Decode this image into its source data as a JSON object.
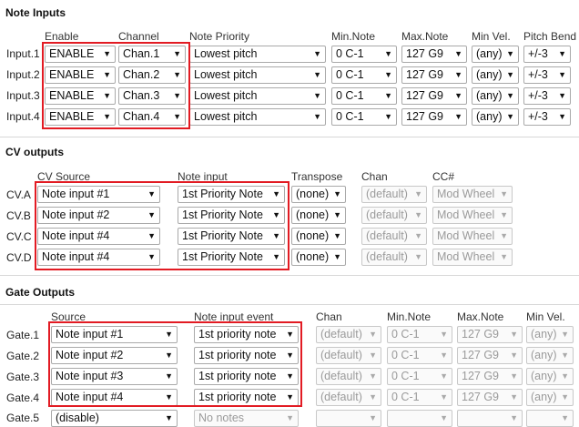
{
  "note_inputs": {
    "title": "Note Inputs",
    "headers": [
      "Enable",
      "Channel",
      "Note Priority",
      "Min.Note",
      "Max.Note",
      "Min Vel.",
      "Pitch Bend"
    ],
    "rows": [
      {
        "label": "Input.1",
        "values": [
          "ENABLE",
          "Chan.1",
          "Lowest pitch",
          "0 C-1",
          "127 G9",
          "(any)",
          "+/-3"
        ]
      },
      {
        "label": "Input.2",
        "values": [
          "ENABLE",
          "Chan.2",
          "Lowest pitch",
          "0 C-1",
          "127 G9",
          "(any)",
          "+/-3"
        ]
      },
      {
        "label": "Input.3",
        "values": [
          "ENABLE",
          "Chan.3",
          "Lowest pitch",
          "0 C-1",
          "127 G9",
          "(any)",
          "+/-3"
        ]
      },
      {
        "label": "Input.4",
        "values": [
          "ENABLE",
          "Chan.4",
          "Lowest pitch",
          "0 C-1",
          "127 G9",
          "(any)",
          "+/-3"
        ]
      }
    ]
  },
  "cv_outputs": {
    "title": "CV outputs",
    "headers": [
      "CV Source",
      "Note input",
      "Transpose",
      "Chan",
      "CC#"
    ],
    "rows": [
      {
        "label": "CV.A",
        "values": [
          "Note input #1",
          "1st Priority Note",
          "(none)",
          "(default)",
          "Mod Wheel"
        ]
      },
      {
        "label": "CV.B",
        "values": [
          "Note input #2",
          "1st Priority Note",
          "(none)",
          "(default)",
          "Mod Wheel"
        ]
      },
      {
        "label": "CV.C",
        "values": [
          "Note input #4",
          "1st Priority Note",
          "(none)",
          "(default)",
          "Mod Wheel"
        ]
      },
      {
        "label": "CV.D",
        "values": [
          "Note input #4",
          "1st Priority Note",
          "(none)",
          "(default)",
          "Mod Wheel"
        ]
      }
    ]
  },
  "gate_outputs": {
    "title": "Gate Outputs",
    "headers": [
      "Source",
      "Note input event",
      "Chan",
      "Min.Note",
      "Max.Note",
      "Min Vel."
    ],
    "rows": [
      {
        "label": "Gate.1",
        "values": [
          "Note input #1",
          "1st priority note",
          "(default)",
          "0 C-1",
          "127 G9",
          "(any)"
        ]
      },
      {
        "label": "Gate.2",
        "values": [
          "Note input #2",
          "1st priority note",
          "(default)",
          "0 C-1",
          "127 G9",
          "(any)"
        ]
      },
      {
        "label": "Gate.3",
        "values": [
          "Note input #3",
          "1st priority note",
          "(default)",
          "0 C-1",
          "127 G9",
          "(any)"
        ]
      },
      {
        "label": "Gate.4",
        "values": [
          "Note input #4",
          "1st priority note",
          "(default)",
          "0 C-1",
          "127 G9",
          "(any)"
        ]
      },
      {
        "label": "Gate.5",
        "values": [
          "(disable)",
          "No notes",
          "",
          "",
          "",
          ""
        ]
      }
    ]
  },
  "colors": {
    "highlight": "#e21b23",
    "disabled_text": "#9a9a9a"
  },
  "icons": {
    "dropdown": "triangle-down-icon"
  }
}
